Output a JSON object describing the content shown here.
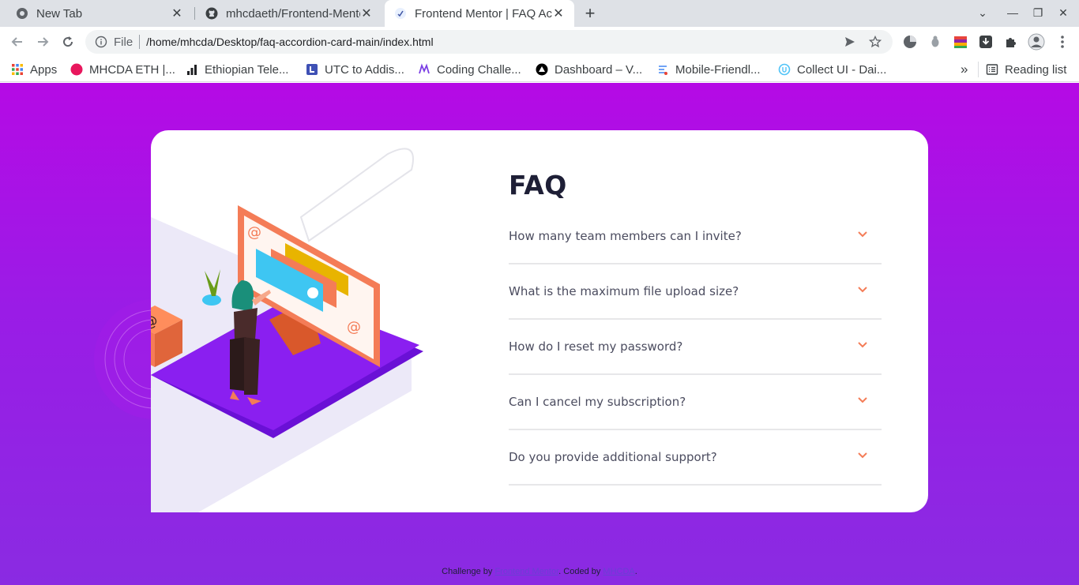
{
  "browser": {
    "tabs": [
      {
        "title": "New Tab",
        "icon": "chrome-icon"
      },
      {
        "title": "mhcdaeth/Frontend-Mentor",
        "icon": "github-icon"
      },
      {
        "title": "Frontend Mentor | FAQ Accordion",
        "icon": "frontend-mentor-icon",
        "active": true
      }
    ],
    "new_tab": "+",
    "address": {
      "scheme_label": "File",
      "url": "/home/mhcda/Desktop/faq-accordion-card-main/index.html"
    },
    "bookmarks": [
      {
        "label": "Apps",
        "icon": "apps-grid-icon"
      },
      {
        "label": "MHCDA ETH |...",
        "icon": "dot-icon",
        "color": "#e8175d"
      },
      {
        "label": "Ethiopian Tele...",
        "icon": "bars-icon"
      },
      {
        "label": "UTC to Addis...",
        "icon": "clock-icon"
      },
      {
        "label": "Coding Challe...",
        "icon": "coding-icon"
      },
      {
        "label": "Dashboard – V...",
        "icon": "vercel-icon"
      },
      {
        "label": "Mobile-Friendl...",
        "icon": "mobile-icon"
      },
      {
        "label": "Collect UI - Dai...",
        "icon": "collect-ui-icon"
      }
    ],
    "overflow": "»",
    "reading_list": "Reading list"
  },
  "faq": {
    "title": "FAQ",
    "questions": [
      "How many team members can I invite?",
      "What is the maximum file upload size?",
      "How do I reset my password?",
      "Can I cancel my subscription?",
      "Do you provide additional support?"
    ]
  },
  "attribution": {
    "prefix": "Challenge by ",
    "link1": "Frontend Mentor",
    "middle": ". Coded by ",
    "link2": "MHCDA",
    "suffix": "."
  },
  "colors": {
    "accent": "#f47c57",
    "title": "#1e1f36",
    "question": "#4b4c5f",
    "gradient_top": "#b50ae5",
    "gradient_bottom": "#8a2be2"
  }
}
